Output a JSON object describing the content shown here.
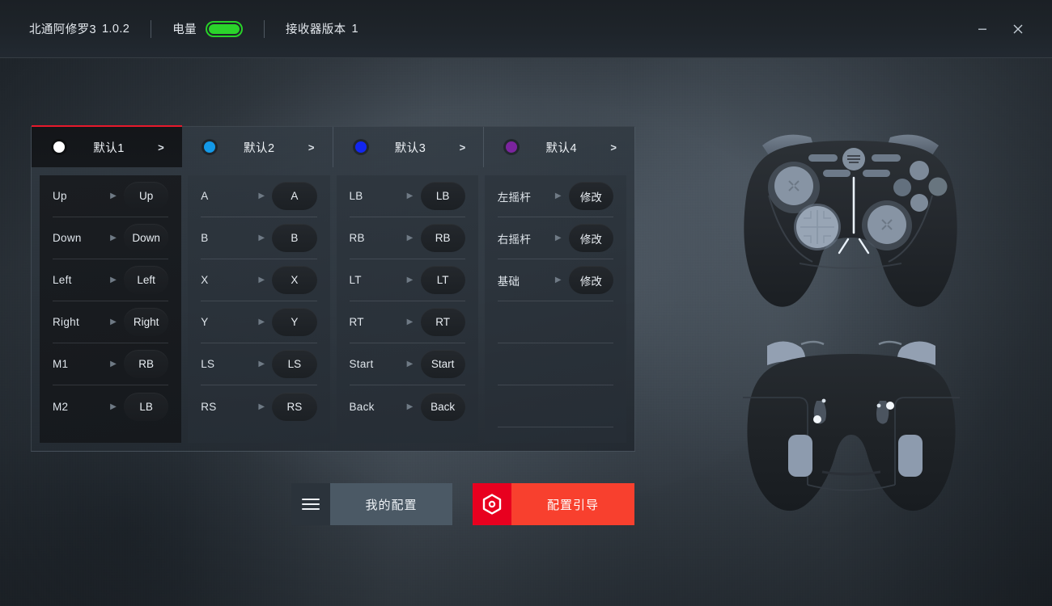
{
  "titlebar": {
    "product": "北通阿修罗3",
    "version": "1.0.2",
    "battery_label": "电量",
    "battery_color": "#2bd42b",
    "receiver_label": "接收器版本",
    "receiver_value": "1",
    "minimize_icon": "minimize-icon",
    "close_icon": "close-icon"
  },
  "tabs": [
    {
      "label": "默认1",
      "dot_color": "#ffffff",
      "chevron": ">",
      "active": true
    },
    {
      "label": "默认2",
      "dot_color": "#1399e8",
      "chevron": ">",
      "active": false
    },
    {
      "label": "默认3",
      "dot_color": "#1226f0",
      "chevron": ">",
      "active": false
    },
    {
      "label": "默认4",
      "dot_color": "#7b249e",
      "chevron": ">",
      "active": false
    }
  ],
  "accent_color": "#e8192c",
  "columns": [
    {
      "name": "dpad-and-paddles",
      "rows": [
        {
          "label": "Up",
          "value": "Up"
        },
        {
          "label": "Down",
          "value": "Down"
        },
        {
          "label": "Left",
          "value": "Left"
        },
        {
          "label": "Right",
          "value": "Right"
        },
        {
          "label": "M1",
          "value": "RB"
        },
        {
          "label": "M2",
          "value": "LB"
        }
      ]
    },
    {
      "name": "face-buttons",
      "rows": [
        {
          "label": "A",
          "value": "A"
        },
        {
          "label": "B",
          "value": "B"
        },
        {
          "label": "X",
          "value": "X"
        },
        {
          "label": "Y",
          "value": "Y"
        },
        {
          "label": "LS",
          "value": "LS"
        },
        {
          "label": "RS",
          "value": "RS"
        }
      ]
    },
    {
      "name": "shoulders-and-system",
      "rows": [
        {
          "label": "LB",
          "value": "LB"
        },
        {
          "label": "RB",
          "value": "RB"
        },
        {
          "label": "LT",
          "value": "LT"
        },
        {
          "label": "RT",
          "value": "RT"
        },
        {
          "label": "Start",
          "value": "Start"
        },
        {
          "label": "Back",
          "value": "Back"
        }
      ]
    },
    {
      "name": "sticks-and-basic",
      "rows": [
        {
          "label": "左摇杆",
          "value": "修改"
        },
        {
          "label": "右摇杆",
          "value": "修改"
        },
        {
          "label": "基础",
          "value": "修改"
        },
        {
          "label": "",
          "value": ""
        },
        {
          "label": "",
          "value": ""
        },
        {
          "label": "",
          "value": ""
        }
      ]
    }
  ],
  "row_arrow": "▶",
  "bottom": {
    "my_config": {
      "label": "我的配置",
      "icon": "hamburger-icon"
    },
    "config_guide": {
      "label": "配置引导",
      "icon": "hexagon-target-icon",
      "color": "#f8402e"
    }
  },
  "controllers": {
    "front_view": "gamepad-front-illustration",
    "back_view": "gamepad-back-illustration"
  }
}
